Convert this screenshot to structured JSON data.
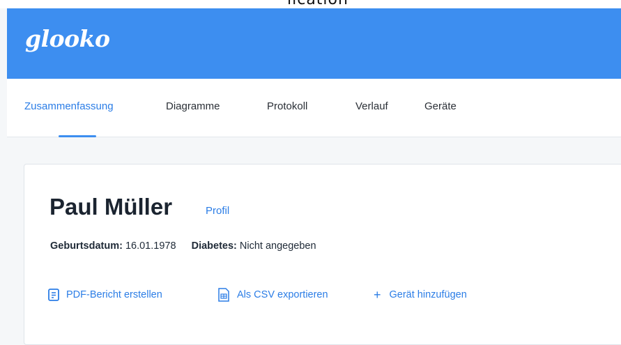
{
  "top_strip": {
    "cut_text": "lication"
  },
  "header": {
    "logo": "glooko",
    "color": "#3d8ef0"
  },
  "nav": {
    "tabs": [
      {
        "label": "Zusammenfassung",
        "active": true
      },
      {
        "label": "Diagramme",
        "active": false
      },
      {
        "label": "Protokoll",
        "active": false
      },
      {
        "label": "Verlauf",
        "active": false
      },
      {
        "label": "Geräte",
        "active": false
      }
    ]
  },
  "patient": {
    "name": "Paul Müller",
    "profile_link": "Profil",
    "birthdate_label": "Geburtsdatum:",
    "birthdate_value": "16.01.1978",
    "diabetes_label": "Diabetes:",
    "diabetes_value": "Nicht angegeben"
  },
  "actions": [
    {
      "label": "PDF-Bericht erstellen",
      "icon": "document-icon"
    },
    {
      "label": "Als CSV exportieren",
      "icon": "table-file-icon"
    },
    {
      "label": "Gerät hinzufügen",
      "icon": "plus-icon"
    }
  ],
  "colors": {
    "accent": "#2b7de6",
    "brand": "#3d8ef0"
  }
}
